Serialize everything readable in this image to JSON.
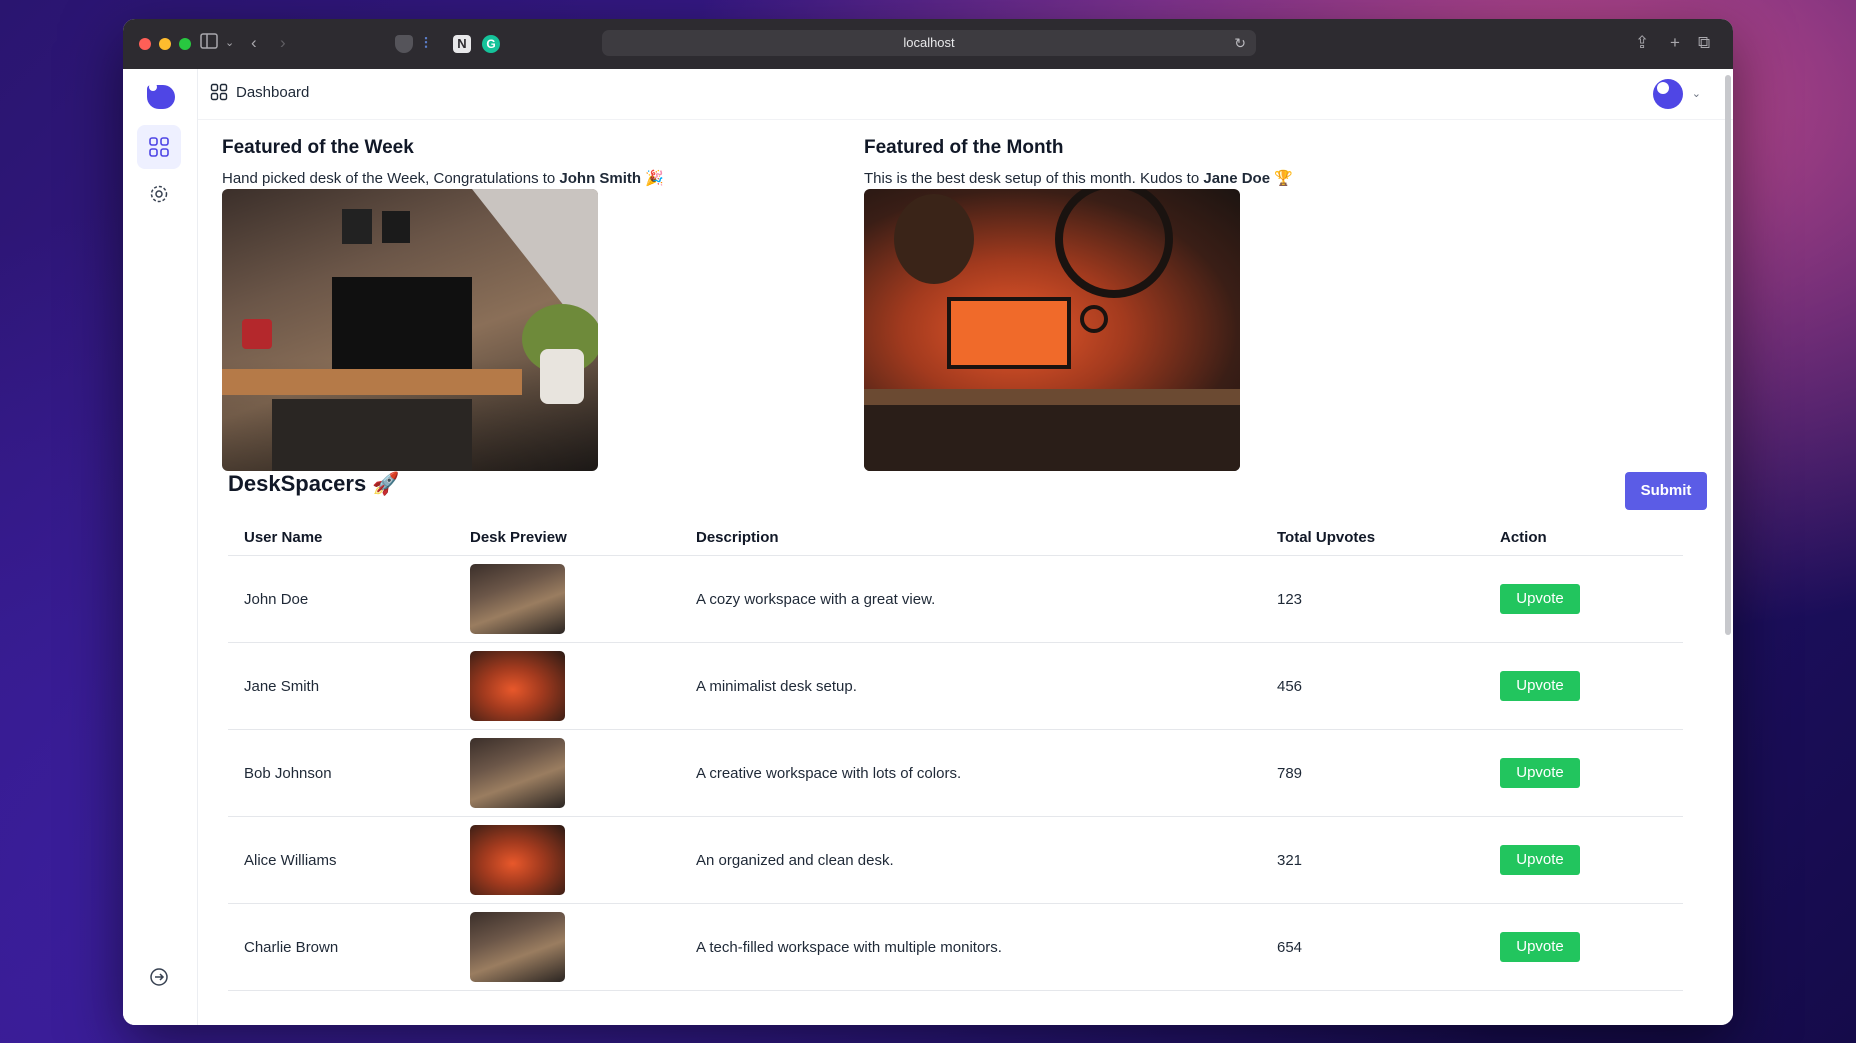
{
  "browser": {
    "url": "localhost",
    "traffic_colors": {
      "close": "#ff5f57",
      "minimize": "#febc2e",
      "maximize": "#28c840"
    }
  },
  "header": {
    "title": "Dashboard"
  },
  "featured_week": {
    "title": "Featured of the Week",
    "text_prefix": "Hand picked desk of the Week, Congratulations to ",
    "name": "John Smith",
    "emoji": "🎉"
  },
  "featured_month": {
    "title": "Featured of the Month",
    "text_prefix": "This is the best desk setup of this month. Kudos to ",
    "name": "Jane Doe",
    "emoji": "🏆"
  },
  "deskspacers": {
    "title": "DeskSpacers 🚀",
    "submit_label": "Submit",
    "columns": [
      "User Name",
      "Desk Preview",
      "Description",
      "Total Upvotes",
      "Action"
    ],
    "rows": [
      {
        "name": "John Doe",
        "description": "A cozy workspace with a great view.",
        "upvotes": "123",
        "action": "Upvote"
      },
      {
        "name": "Jane Smith",
        "description": "A minimalist desk setup.",
        "upvotes": "456",
        "action": "Upvote"
      },
      {
        "name": "Bob Johnson",
        "description": "A creative workspace with lots of colors.",
        "upvotes": "789",
        "action": "Upvote"
      },
      {
        "name": "Alice Williams",
        "description": "An organized and clean desk.",
        "upvotes": "321",
        "action": "Upvote"
      },
      {
        "name": "Charlie Brown",
        "description": "A tech-filled workspace with multiple monitors.",
        "upvotes": "654",
        "action": "Upvote"
      }
    ]
  },
  "colors": {
    "accent": "#5b5ce6",
    "upvote": "#22c55e",
    "brand": "#4f46e5"
  }
}
